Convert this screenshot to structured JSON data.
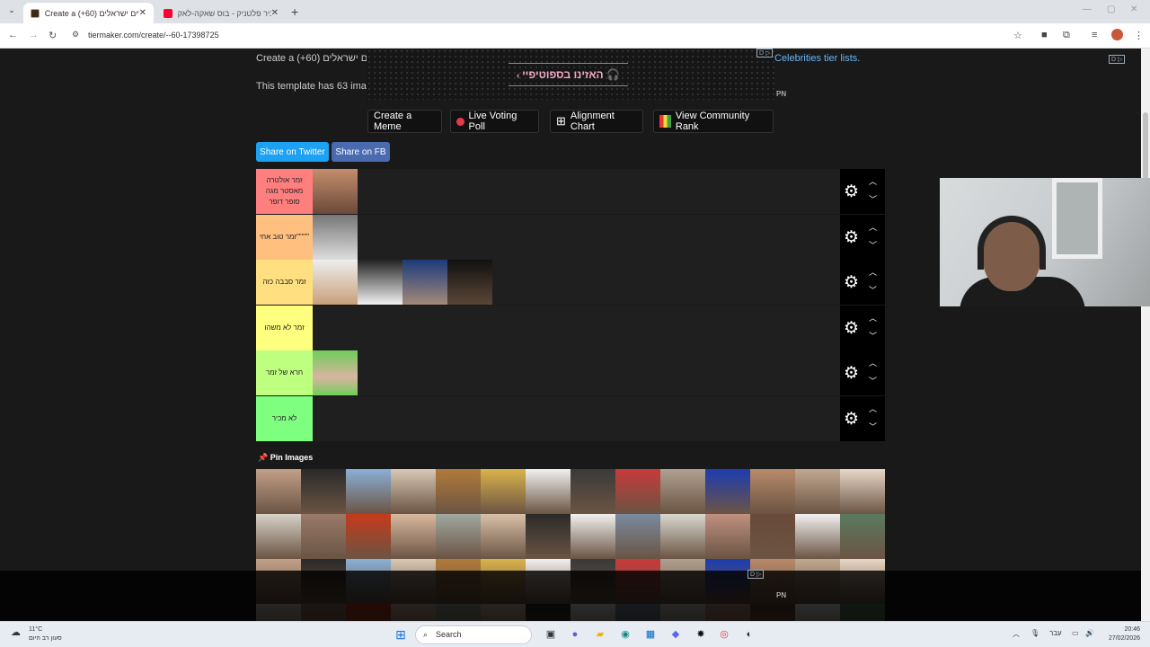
{
  "browser": {
    "tabs": [
      {
        "title": "Create a (+60) אחרים ישראלים ...",
        "active": true
      },
      {
        "title": "רביר פלטניק - בוס שאקה-לאק",
        "active": false
      }
    ],
    "url": "tiermaker.com/create/--60-17398725"
  },
  "page": {
    "intro_line1": "Create a (+60) רים ישראלים",
    "intro_line2": "This template has 63 imag",
    "celebrities_link": "Celebrities tier lists.",
    "banner_text": "האזינו בספוטיפיי",
    "banner_icons": [
      "chevron-left-icon",
      "headphones-icon"
    ],
    "ad_label": "D ▷",
    "pn_label": "PN",
    "actions": [
      {
        "label": "Create a Meme",
        "icon": ""
      },
      {
        "label": "Live Voting Poll",
        "icon": "record-dot-icon",
        "color": "#e53950"
      },
      {
        "label": "Alignment Chart",
        "icon": "grid-icon"
      },
      {
        "label": "View Community Rank",
        "icon": "rank-grid-icon"
      }
    ],
    "share": [
      {
        "label": "Share on Twitter",
        "color": "#1da1f2"
      },
      {
        "label": "Share on FB",
        "color": "#3b5998"
      }
    ],
    "tiers": [
      {
        "label": "זמר אולטרה מאסטר מגה סופר דופר",
        "color": "#ff7f7f",
        "images": 1
      },
      {
        "label": "זמר טוב אחי\"\"\"\"\"",
        "color": "#ffbf7f",
        "images": 1
      },
      {
        "label": "זמר סבבה כזה",
        "color": "#ffdf7f",
        "images": 4
      },
      {
        "label": "זמר לא משהו",
        "color": "#ffff7f",
        "images": 0
      },
      {
        "label": "חרא של זמר",
        "color": "#bfff7f",
        "images": 1
      },
      {
        "label": "לא מכיר",
        "color": "#7fff7f",
        "images": 0
      }
    ],
    "pin_label": "Pin Images",
    "pin_icon": "pin-icon"
  },
  "taskbar": {
    "weather_temp": "11°C",
    "weather_desc": "סעון רב היום",
    "search_placeholder": "Search",
    "lang": "עבר",
    "time": "20:46",
    "date": "27/02/2026"
  }
}
